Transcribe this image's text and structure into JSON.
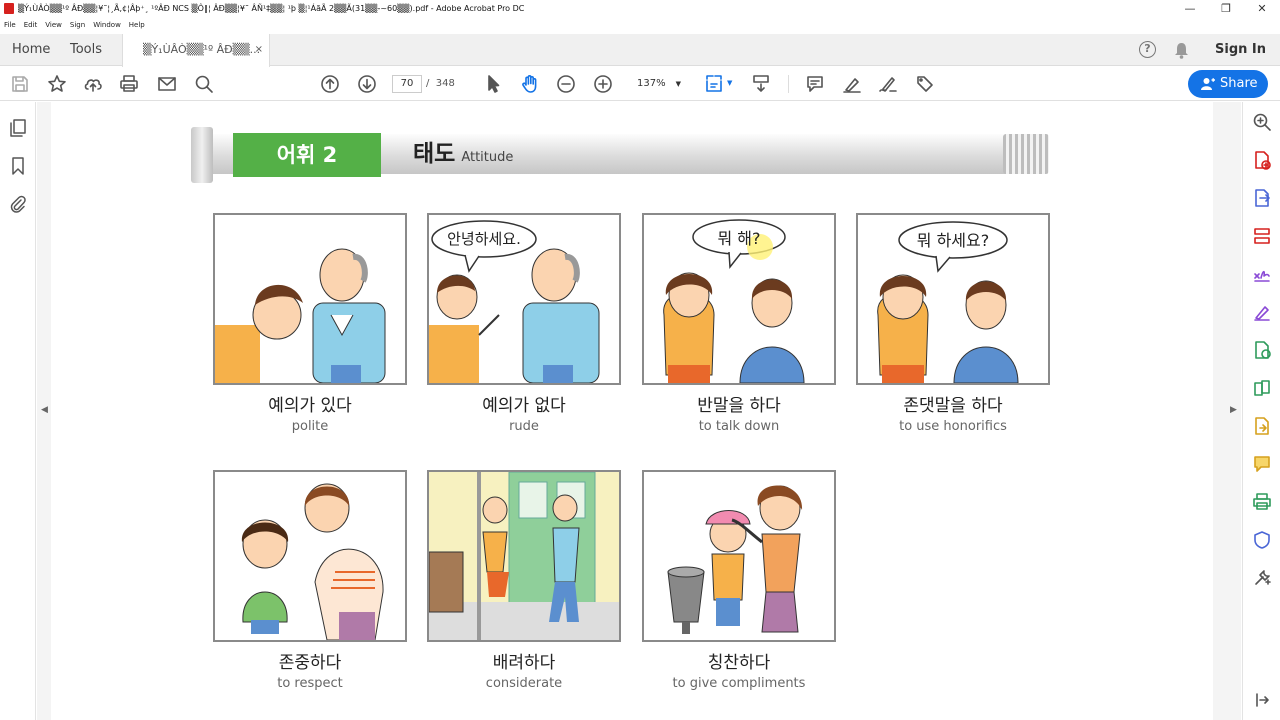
{
  "window": {
    "title": "▒Ý₁ÙÂÒ▒▒¹º ÂÐ▒▒¦¥˜¦¸Ã,¢¦Âþ⁺¸ ¹ºÂÐ NCS ▒Ô‖¦ ÂÐ▒▒¦¥˜ ÂÑ¹‡▒▒¦ ¹þ ▒¦¹ÁãÃ 2▒▒Ã(31▒▒-~60▒▒).pdf - Adobe Acrobat Pro DC",
    "minimize": "—",
    "maximize": "❐",
    "close": "✕"
  },
  "menu": [
    "File",
    "Edit",
    "View",
    "Sign",
    "Window",
    "Help"
  ],
  "tabs": {
    "home": "Home",
    "tools": "Tools",
    "document": "▒Ý₁ÙÂÒ▒▒¹º ÂÐ▒▒...",
    "document_close": "×",
    "help": "?",
    "sign_in": "Sign In"
  },
  "toolbar": {
    "current_page": "70",
    "page_separator": "/",
    "total_pages": "348",
    "zoom": "137%",
    "share": "Share"
  },
  "page": {
    "vocab_label": "어휘 2",
    "category_ko": "태도",
    "category_en": "Attitude",
    "cards": [
      {
        "ko": "예의가 있다",
        "en": "polite"
      },
      {
        "ko": "예의가 없다",
        "en": "rude",
        "bubble": "안녕하세요."
      },
      {
        "ko": "반말을 하다",
        "en": "to talk down",
        "bubble": "뭐 해?"
      },
      {
        "ko": "존댓말을 하다",
        "en": "to use honorifics",
        "bubble": "뭐 하세요?"
      },
      {
        "ko": "존중하다",
        "en": "to respect"
      },
      {
        "ko": "배려하다",
        "en": "considerate"
      },
      {
        "ko": "칭찬하다",
        "en": "to give compliments"
      }
    ]
  },
  "colors": {
    "accent": "#1473e6",
    "vocab_green": "#54b047"
  }
}
